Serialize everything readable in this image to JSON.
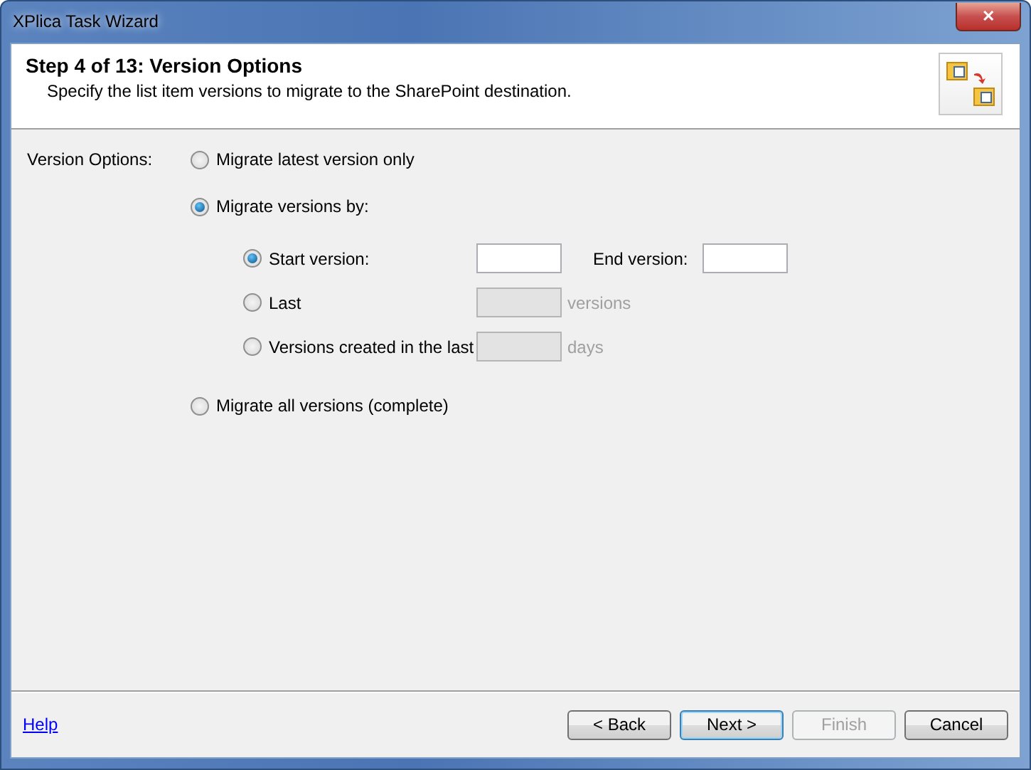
{
  "window": {
    "title": "XPlica Task Wizard",
    "close_glyph": "✕"
  },
  "header": {
    "title": "Step 4 of 13: Version Options",
    "subtitle": "Specify the list item versions to migrate to the SharePoint destination."
  },
  "section_label": "Version Options:",
  "options": [
    {
      "label": "Migrate latest version only",
      "selected": false
    },
    {
      "label": "Migrate versions by:",
      "selected": true,
      "sub_options": [
        {
          "kind": "range",
          "label": "Start version:",
          "selected": true,
          "disabled": false,
          "end_label": "End version:"
        },
        {
          "kind": "count",
          "label": "Last",
          "selected": false,
          "disabled": true,
          "unit": "versions"
        },
        {
          "kind": "count",
          "label": "Versions created in the last",
          "selected": false,
          "disabled": true,
          "unit": "days"
        }
      ]
    },
    {
      "label": "Migrate all versions (complete)",
      "selected": false
    }
  ],
  "help_link": "Help",
  "buttons": [
    {
      "label": "< Back",
      "disabled": false,
      "default": false
    },
    {
      "label": "Next >",
      "disabled": false,
      "default": true
    },
    {
      "label": "Finish",
      "disabled": true,
      "default": false
    },
    {
      "label": "Cancel",
      "disabled": false,
      "default": false
    }
  ]
}
